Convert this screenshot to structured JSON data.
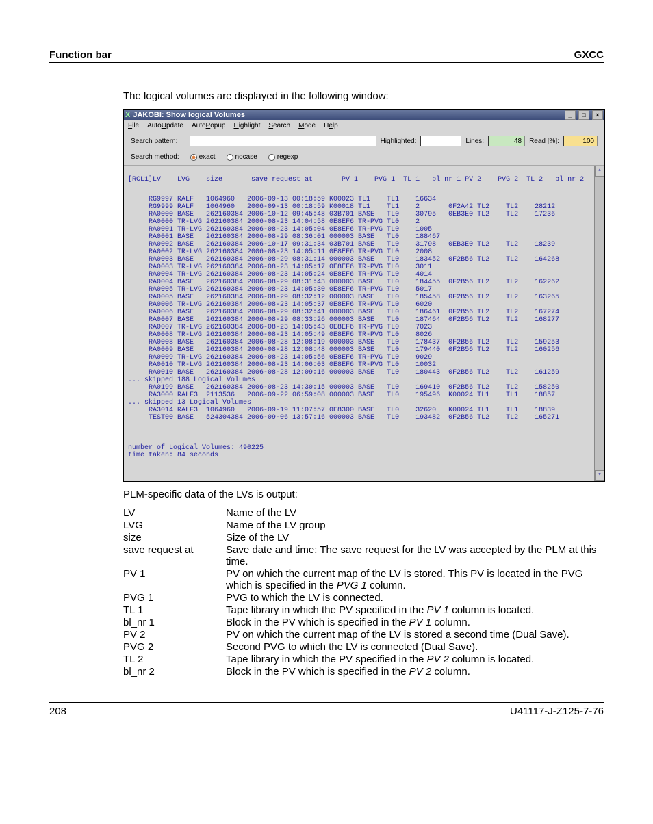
{
  "header": {
    "left": "Function bar",
    "right": "GXCC"
  },
  "intro": "The logical volumes are displayed in the following window:",
  "window": {
    "title": "JAKOBI: Show logical Volumes",
    "menus": [
      "File",
      "AutoUpdate",
      "AutoPopup",
      "Highlight",
      "Search",
      "Mode",
      "Help"
    ],
    "search_pattern_label": "Search pattern:",
    "highlighted_label": "Highlighted:",
    "lines_label": "Lines:",
    "lines_value": "48",
    "read_label": "Read [%]:",
    "read_value": "100",
    "search_method_label": "Search method:",
    "radios": [
      "exact",
      "nocase",
      "regexp"
    ],
    "columns": "[RCL1]LV    LVG    size       save request at       PV 1    PVG 1  TL 1   bl_nr 1 PV 2    PVG 2  TL 2   bl_nr 2",
    "rows": [
      "     RG9997 RALF   1064960   2006-09-13 00:18:59 K00023 TL1    TL1    16634",
      "     RG9999 RALF   1064960   2006-09-13 00:18:59 K00018 TL1    TL1    2       0F2A42 TL2    TL2    28212",
      "     RA0000 BASE   262160384 2006-10-12 09:45:48 03B701 BASE   TL0    30795   0EB3E0 TL2    TL2    17236",
      "     RA0000 TR-LVG 262160384 2006-08-23 14:04:58 0E8EF6 TR-PVG TL0    2",
      "     RA0001 TR-LVG 262160384 2006-08-23 14:05:04 0E8EF6 TR-PVG TL0    1005",
      "     RA0001 BASE   262160384 2006-08-29 08:36:01 000003 BASE   TL0    188467",
      "     RA0002 BASE   262160384 2006-10-17 09:31:34 03B701 BASE   TL0    31798   0EB3E0 TL2    TL2    18239",
      "     RA0002 TR-LVG 262160384 2006-08-23 14:05:11 0E8EF6 TR-PVG TL0    2008",
      "     RA0003 BASE   262160384 2006-08-29 08:31:14 000003 BASE   TL0    183452  0F2B56 TL2    TL2    164268",
      "     RA0003 TR-LVG 262160384 2006-08-23 14:05:17 0E8EF6 TR-PVG TL0    3011",
      "     RA0004 TR-LVG 262160384 2006-08-23 14:05:24 0E8EF6 TR-PVG TL0    4014",
      "     RA0004 BASE   262160384 2006-08-29 08:31:43 000003 BASE   TL0    184455  0F2B56 TL2    TL2    162262",
      "     RA0005 TR-LVG 262160384 2006-08-23 14:05:30 0E8EF6 TR-PVG TL0    5017",
      "     RA0005 BASE   262160384 2006-08-29 08:32:12 000003 BASE   TL0    185458  0F2B56 TL2    TL2    163265",
      "     RA0006 TR-LVG 262160384 2006-08-23 14:05:37 0E8EF6 TR-PVG TL0    6020",
      "     RA0006 BASE   262160384 2006-08-29 08:32:41 000003 BASE   TL0    186461  0F2B56 TL2    TL2    167274",
      "     RA0007 BASE   262160384 2006-08-29 08:33:26 000003 BASE   TL0    187464  0F2B56 TL2    TL2    168277",
      "     RA0007 TR-LVG 262160384 2006-08-23 14:05:43 0E8EF6 TR-PVG TL0    7023",
      "     RA0008 TR-LVG 262160384 2006-08-23 14:05:49 0E8EF6 TR-PVG TL0    8026",
      "     RA0008 BASE   262160384 2006-08-28 12:08:19 000003 BASE   TL0    178437  0F2B56 TL2    TL2    159253",
      "     RA0009 BASE   262160384 2006-08-28 12:08:48 000003 BASE   TL0    179440  0F2B56 TL2    TL2    160256",
      "     RA0009 TR-LVG 262160384 2006-08-23 14:05:56 0E8EF6 TR-PVG TL0    9029",
      "     RA0010 TR-LVG 262160384 2006-08-23 14:06:03 0E8EF6 TR-PVG TL0    10032",
      "     RA0010 BASE   262160384 2006-08-28 12:09:16 000003 BASE   TL0    180443  0F2B56 TL2    TL2    161259",
      "... skipped 188 Logical Volumes",
      "     RA0199 BASE   262160384 2006-08-23 14:30:15 000003 BASE   TL0    169410  0F2B56 TL2    TL2    158250",
      "     RA3000 RALF3  2113536   2006-09-22 06:59:08 000003 BASE   TL0    195496  K00024 TL1    TL1    18857",
      "... skipped 13 Logical Volumes",
      "     RA3014 RALF3  1064960   2006-09-19 11:07:57 0E8300 BASE   TL0    32620   K00024 TL1    TL1    18839",
      "     TEST00 BASE   524304384 2006-09-06 13:57:16 000003 BASE   TL0    193482  0F2B56 TL2    TL2    165271"
    ],
    "summary1": "number of Logical Volumes: 490225",
    "summary2": "time taken: 84 seconds"
  },
  "caption": "PLM-specific data of the LVs is output:",
  "defs": [
    {
      "term": "LV",
      "val": "Name of the LV"
    },
    {
      "term": "LVG",
      "val": "Name of the LV group"
    },
    {
      "term": "size",
      "val": "Size of the LV"
    },
    {
      "term": "save request at",
      "val": "Save date and time: The save request for the LV was accepted by the PLM at this time."
    },
    {
      "term": "PV 1",
      "val": "PV on which the current map of the LV is stored. This PV is located in the PVG which is specified in the <i>PVG 1</i> column."
    },
    {
      "term": "PVG 1",
      "val": "PVG to which the LV is connected."
    },
    {
      "term": "TL 1",
      "val": "Tape library in which the PV specified in the <i>PV 1</i> column is located."
    },
    {
      "term": "bl_nr 1",
      "val": "Block in the PV which is specified in the <i>PV 1</i> column."
    },
    {
      "term": "PV 2",
      "val": "PV on which the current map of the LV is stored a second time (Dual Save)."
    },
    {
      "term": "PVG 2",
      "val": "Second PVG to which the LV is connected (Dual Save)."
    },
    {
      "term": "TL 2",
      "val": "Tape library in which the PV specified in the <i>PV 2</i> column is located."
    },
    {
      "term": "bl_nr 2",
      "val": "Block in the PV which is specified in the <i>PV 2</i> column."
    }
  ],
  "footer": {
    "left": "208",
    "right": "U41117-J-Z125-7-76"
  }
}
